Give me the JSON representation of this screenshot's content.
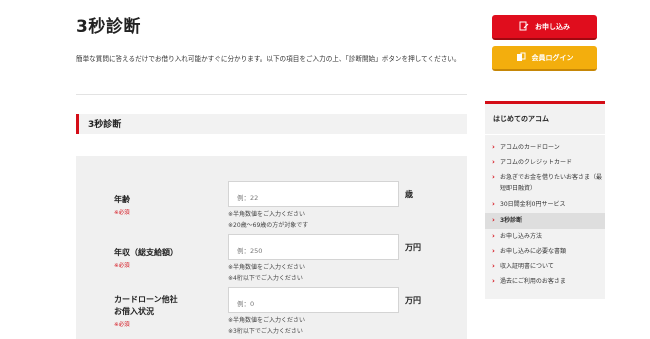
{
  "page": {
    "title": "3秒診断",
    "intro": "簡単な質問に答えるだけでお借り入れ可能かすぐに分かります。以下の項目をご入力の上、「診断開始」ボタンを押してください。"
  },
  "section": {
    "heading": "3秒診断"
  },
  "form": {
    "required_label": "※必須",
    "age": {
      "label": "年齢",
      "placeholder": "例：22",
      "unit": "歳",
      "note1": "※半角数値をご入力ください",
      "note2": "※20歳～69歳の方が対象です"
    },
    "income": {
      "label": "年収（総支給額）",
      "placeholder": "例：250",
      "unit": "万円",
      "note1": "※半角数値をご入力ください",
      "note2": "※4桁以下でご入力ください"
    },
    "other_loans": {
      "label_line1": "カードローン他社",
      "label_line2": "お借入状況",
      "placeholder": "例：0",
      "unit": "万円",
      "note1": "※半角数値をご入力ください",
      "note2": "※3桁以下でご入力ください"
    }
  },
  "sidebar": {
    "apply_button": "お申し込み",
    "login_button": "会員ログイン",
    "section_title": "はじめてのアコム",
    "items": [
      {
        "label": "アコムのカードローン"
      },
      {
        "label": "アコムのクレジットカード"
      },
      {
        "label": "お急ぎでお金を借りたいお客さま（最短即日融資）"
      },
      {
        "label": "30日間金利0円サービス"
      },
      {
        "label": "3秒診断"
      },
      {
        "label": "お申し込み方法"
      },
      {
        "label": "お申し込みに必要な書類"
      },
      {
        "label": "収入証明書について"
      },
      {
        "label": "過去にご利用のお客さま"
      }
    ]
  },
  "colors": {
    "brand_red": "#d40d17",
    "apply_red": "#e00d1d",
    "login_yellow": "#f3ae0d"
  }
}
